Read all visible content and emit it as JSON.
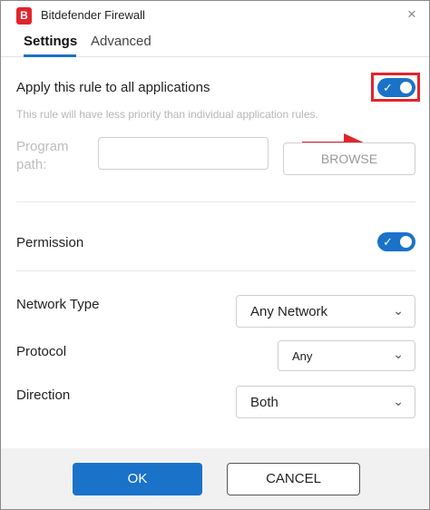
{
  "window": {
    "title": "Bitdefender Firewall",
    "logo_letter": "B",
    "close_glyph": "×"
  },
  "tabs": [
    {
      "label": "Settings",
      "active": true
    },
    {
      "label": "Advanced",
      "active": false
    }
  ],
  "apply_rule": {
    "label": "Apply this rule to all applications",
    "hint": "This rule will have less priority than individual application rules.",
    "enabled": true
  },
  "program_path": {
    "label": "Program path:",
    "value": "",
    "browse_label": "BROWSE"
  },
  "permission": {
    "label": "Permission",
    "enabled": true
  },
  "network_type": {
    "label": "Network Type",
    "selected": "Any Network"
  },
  "protocol": {
    "label": "Protocol",
    "selected": "Any"
  },
  "direction": {
    "label": "Direction",
    "selected": "Both"
  },
  "footer": {
    "ok_label": "OK",
    "cancel_label": "CANCEL"
  },
  "icons": {
    "toggle_check": "check-icon",
    "chevron": "chevron-down-icon",
    "arrow": "red-arrow-annotation"
  },
  "colors": {
    "accent": "#1a73c9",
    "brand": "#e0262c",
    "annotation": "#e0262c"
  }
}
